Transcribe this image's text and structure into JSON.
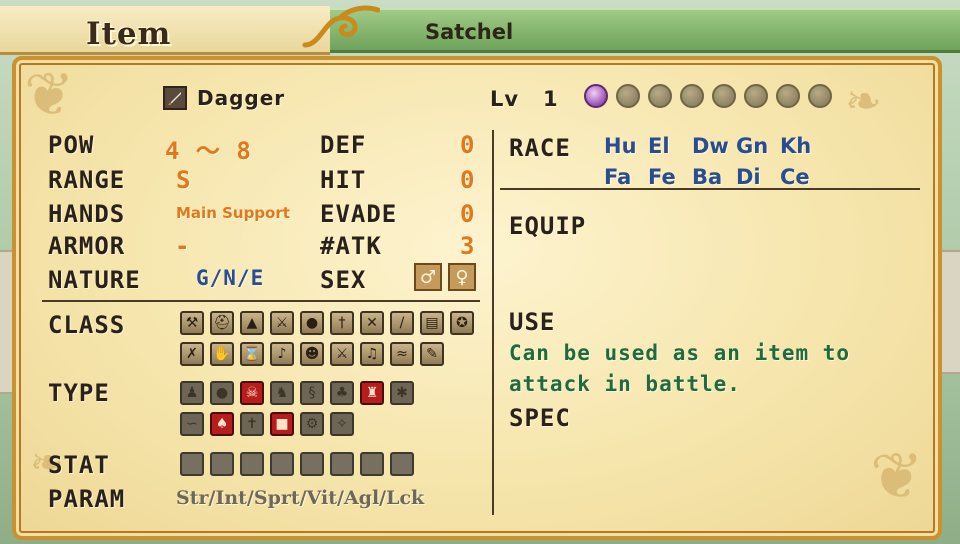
{
  "tabs": {
    "item": "Item",
    "satchel": "Satchel"
  },
  "item": {
    "name": "Dagger",
    "icon": "dagger-icon",
    "lv_label": "Lv",
    "lv_value": "1",
    "level_filled": 1,
    "level_total": 8
  },
  "stats": {
    "pow_label": "POW",
    "pow_value": "4 ～ 8",
    "range_label": "RANGE",
    "range_value": "S",
    "hands_label": "HANDS",
    "hands_value": "Main Support",
    "armor_label": "ARMOR",
    "armor_value": "-",
    "nature_label": "NATURE",
    "nature_value": "G/N/E",
    "def_label": "DEF",
    "def_value": "0",
    "hit_label": "HIT",
    "hit_value": "0",
    "evade_label": "EVADE",
    "evade_value": "0",
    "atk_label": "#ATK",
    "atk_value": "3",
    "sex_label": "SEX",
    "sex_male": "♂",
    "sex_female": "♀"
  },
  "class": {
    "label": "CLASS",
    "icons": [
      "hammer-icon",
      "helmet-icon",
      "witch-hat-icon",
      "axe-icon",
      "orb-icon",
      "sword-icon",
      "crossed-bones-icon",
      "wand-icon",
      "book-icon",
      "pentagram-icon",
      "crossed-staves-icon",
      "hand-icon",
      "hourglass-icon",
      "horn-icon",
      "mask-icon",
      "crossed-swords-icon",
      "bird-icon",
      "wing-icon",
      "quill-icon"
    ]
  },
  "type": {
    "label": "TYPE",
    "icons": [
      "humanoid-icon",
      "blob-icon",
      "demon-icon",
      "beast-icon",
      "serpent-icon",
      "plant-icon",
      "fiend-icon",
      "insect-icon",
      "worm-icon",
      "dragon-icon",
      "undead-icon",
      "golem-icon",
      "machine-icon",
      "spirit-icon"
    ],
    "red": [
      2,
      6,
      9,
      11
    ]
  },
  "stat": {
    "label": "STAT",
    "count": 8
  },
  "param": {
    "label": "PARAM",
    "value": "Str/Int/Sprt/Vit/Agl/Lck"
  },
  "race": {
    "label": "RACE",
    "row1": [
      "Hu",
      "El",
      "Dw",
      "Gn",
      "Kh"
    ],
    "row2": [
      "Fa",
      "Fe",
      "Ba",
      "Di",
      "Ce"
    ]
  },
  "equip": {
    "label": "EQUIP"
  },
  "use": {
    "label": "USE",
    "line1": "Can be used as an item to",
    "line2": "attack in battle."
  },
  "spec": {
    "label": "SPEC"
  },
  "colors": {
    "value_orange": "#e0781e",
    "race_blue": "#2a4d8f",
    "use_green": "#1f6b3d",
    "satchel_green": "#6fa35c"
  }
}
